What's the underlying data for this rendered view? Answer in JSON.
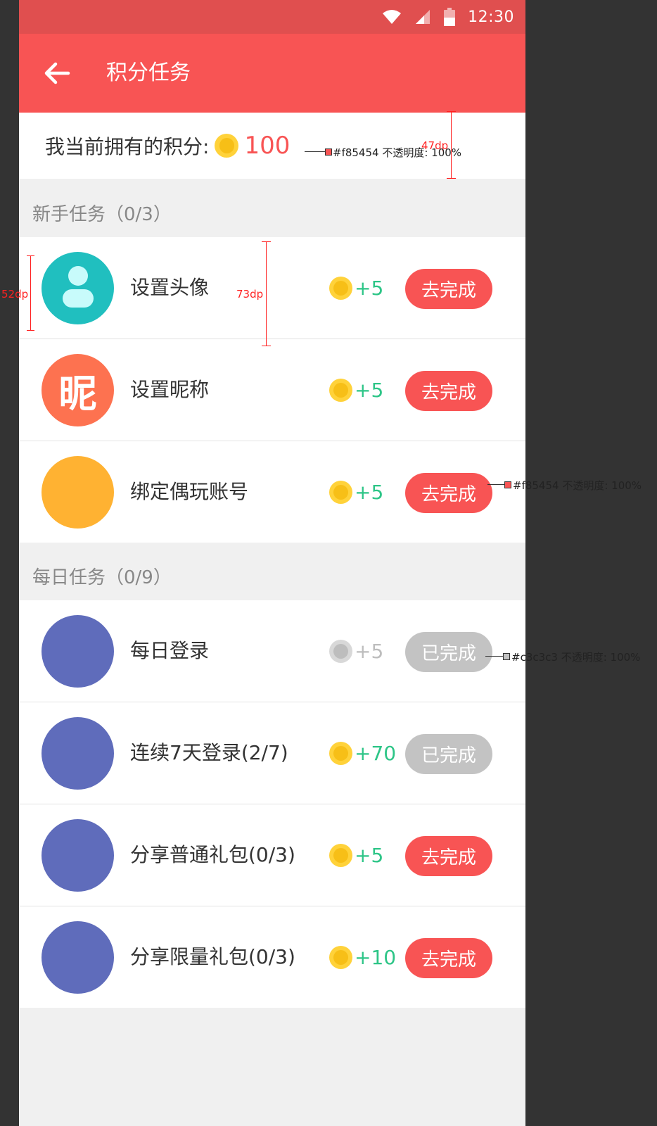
{
  "status_bar": {
    "time": "12:30"
  },
  "app_bar": {
    "title": "积分任务"
  },
  "points": {
    "label": "我当前拥有的积分:",
    "value": "100"
  },
  "sections": [
    {
      "title": "新手任务（0/3）",
      "tasks": [
        {
          "label": "设置头像",
          "reward": "+5",
          "button": "去完成",
          "done": false,
          "avatar_color": "#20bfbf"
        },
        {
          "label": "设置昵称",
          "reward": "+5",
          "button": "去完成",
          "done": false,
          "avatar_color": "#fd7250",
          "avatar_glyph": "昵"
        },
        {
          "label": "绑定偶玩账号",
          "reward": "+5",
          "button": "去完成",
          "done": false,
          "avatar_color": "#ffb232"
        }
      ]
    },
    {
      "title": "每日任务（0/9）",
      "tasks": [
        {
          "label": "每日登录",
          "reward": "+5",
          "button": "已完成",
          "done": true,
          "avatar_color": "#5f6cbb"
        },
        {
          "label": "连续7天登录(2/7)",
          "reward": "+70",
          "button": "已完成",
          "done": false,
          "avatar_color": "#5f6cbb"
        },
        {
          "label": "分享普通礼包(0/3)",
          "reward": "+5",
          "button": "去完成",
          "done": false,
          "avatar_color": "#5f6cbb"
        },
        {
          "label": "分享限量礼包(0/3)",
          "reward": "+10",
          "button": "去完成",
          "done": false,
          "avatar_color": "#5f6cbb"
        }
      ]
    }
  ],
  "annotations": {
    "points_color": "#f85454 不透明度: 100%",
    "points_height": "47dp",
    "avatar_size": "52dp",
    "row_height": "73dp",
    "button_color": "#f85454 不透明度: 100%",
    "done_button_color": "#c3c3c3 不透明度: 100%"
  },
  "colors": {
    "primary": "#f85454",
    "status_bar": "#e04f4f",
    "reward_green": "#2dc587",
    "disabled": "#c3c3c3"
  }
}
